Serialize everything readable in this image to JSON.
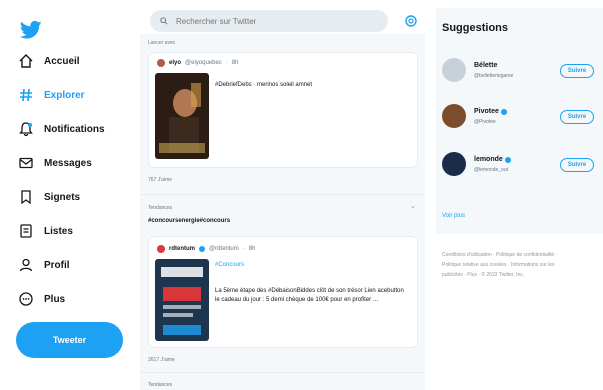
{
  "nav": {
    "items": [
      {
        "label": "Accueil",
        "icon": "home-icon"
      },
      {
        "label": "Explorer",
        "icon": "hashtag-icon",
        "active": true
      },
      {
        "label": "Notifications",
        "icon": "bell-icon"
      },
      {
        "label": "Messages",
        "icon": "mail-icon"
      },
      {
        "label": "Signets",
        "icon": "bookmark-icon"
      },
      {
        "label": "Listes",
        "icon": "list-icon"
      },
      {
        "label": "Profil",
        "icon": "user-icon"
      },
      {
        "label": "Plus",
        "icon": "more-icon"
      }
    ],
    "tweet_button": "Tweeter"
  },
  "search": {
    "placeholder": "Rechercher sur Twitter"
  },
  "feed": {
    "section1": "Lancer avec",
    "tweet1": {
      "author": "elyo",
      "handle": "@elyoquebec",
      "time": "8h",
      "text": "#DebriefDebs · merinos soleil amnet",
      "likes": "767 J'aime"
    },
    "section2": "Tendances",
    "trend_tag": "#concoursenergie#concours",
    "tweet2": {
      "author": "rdtentum",
      "handle": "@rdtentum",
      "time": "8h",
      "tag": "#Concours",
      "text": "La 5ème étape des #DébaisonBiddes clôt de son trésor Lien acebutton le cadeau du jour : 5 demi chèque de 100€ pour en profiter …",
      "likes": "2617 J'aime"
    },
    "section3": "Tendances"
  },
  "suggestions": {
    "title": "Suggestions",
    "items": [
      {
        "name": "Bélette",
        "handle": "@belletterlegame",
        "follow": "Suivre",
        "avatar_color": "#c9d1d8",
        "verified": false
      },
      {
        "name": "Pivotee",
        "handle": "@Pivotee",
        "follow": "Suivre",
        "avatar_color": "#7a4e2d",
        "verified": true
      },
      {
        "name": "lemonde",
        "handle": "@lemonde_out",
        "follow": "Suivre",
        "avatar_color": "#1a2c4a",
        "verified": true
      }
    ],
    "more_link": "Voir plus",
    "footer": "Conditions d'utilisation · Politique de confidentialité · Politique relative aux cookies · Informations sur les publicités · Plus · © 2022 Twitter, Inc."
  },
  "colors": {
    "brand": "#1da1f2",
    "text": "#14171a",
    "muted": "#657786",
    "panel": "#f5f8fa"
  }
}
